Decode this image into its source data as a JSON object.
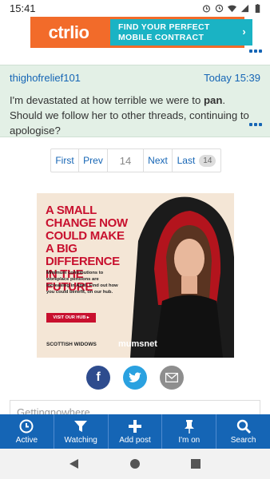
{
  "status": {
    "time": "15:41"
  },
  "top_ad": {
    "logo": "ctrlio",
    "cta_line1": "FIND YOUR PERFECT",
    "cta_line2": "MOBILE CONTRACT",
    "arrow": "›"
  },
  "post": {
    "username": "thighofrelief101",
    "timestamp": "Today 15:39",
    "body_before": "I'm devastated at how terrible we were to ",
    "body_bold": "pan",
    "body_after": ". Should we follow her to other threads, continuing to apologise?"
  },
  "pager": {
    "first": "First",
    "prev": "Prev",
    "current": "14",
    "next": "Next",
    "last": "Last",
    "last_badge": "14"
  },
  "main_ad": {
    "headline": "A SMALL CHANGE NOW COULD MAKE A BIG DIFFERENCE IN THE FUTURE",
    "body": "Minimum contributions to workplace pensions are increasing in April. Find out how you could benefit, on our hub.",
    "button": "VISIT OUR HUB ▸",
    "brand1": "SCOTTISH WIDOWS",
    "brand2": "mumsnet"
  },
  "reply": {
    "text": "Gettingnowhere"
  },
  "tabs": [
    {
      "label": "Active",
      "icon": "clock-icon"
    },
    {
      "label": "Watching",
      "icon": "filter-icon"
    },
    {
      "label": "Add post",
      "icon": "plus-icon"
    },
    {
      "label": "I'm on",
      "icon": "pin-icon"
    },
    {
      "label": "Search",
      "icon": "search-icon"
    }
  ],
  "colors": {
    "accent": "#1565b5",
    "post_bg": "#e3f0e6",
    "ad_orange": "#f26b2a",
    "ad_teal": "#1ab3c4",
    "ad_red": "#c8102e"
  }
}
